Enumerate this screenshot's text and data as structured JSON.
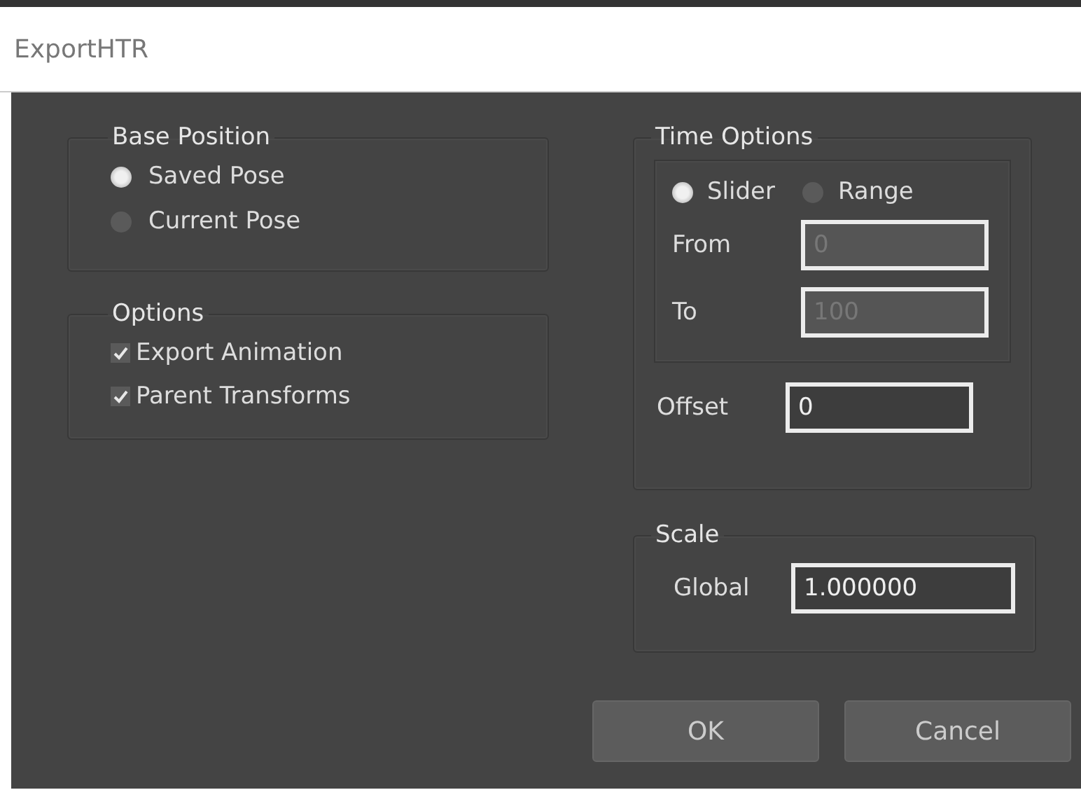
{
  "window": {
    "title": "ExportHTR"
  },
  "base_position": {
    "title": "Base Position",
    "options": [
      {
        "label": "Saved Pose",
        "selected": true
      },
      {
        "label": "Current Pose",
        "selected": false
      }
    ]
  },
  "options": {
    "title": "Options",
    "items": [
      {
        "label": "Export Animation",
        "checked": true
      },
      {
        "label": "Parent Transforms",
        "checked": true
      }
    ]
  },
  "time_options": {
    "title": "Time Options",
    "modes": [
      {
        "label": "Slider",
        "selected": true
      },
      {
        "label": "Range",
        "selected": false
      }
    ],
    "from": {
      "label": "From",
      "value": "0",
      "disabled": true
    },
    "to": {
      "label": "To",
      "value": "100",
      "disabled": true
    },
    "offset": {
      "label": "Offset",
      "value": "0",
      "disabled": false
    }
  },
  "scale": {
    "title": "Scale",
    "global": {
      "label": "Global",
      "value": "1.000000"
    }
  },
  "buttons": [
    {
      "label": "OK"
    },
    {
      "label": "Cancel"
    }
  ]
}
